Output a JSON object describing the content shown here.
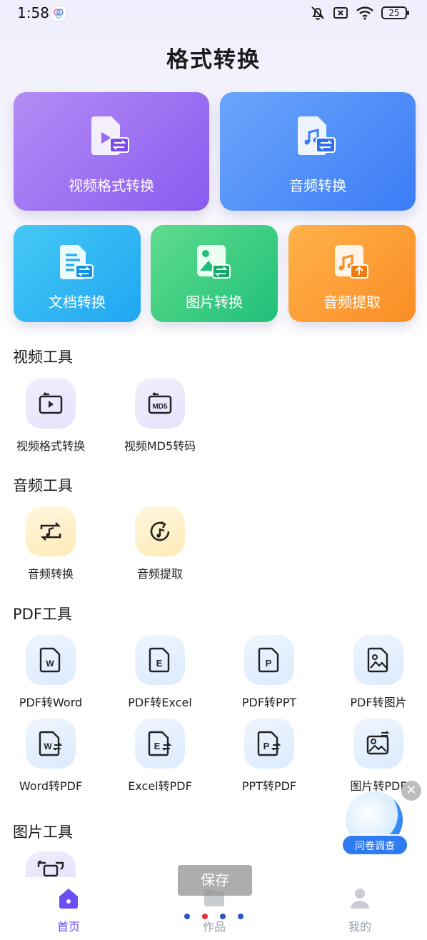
{
  "status_bar": {
    "time": "1:58",
    "battery": "25"
  },
  "page_title": "格式转换",
  "top_cards": [
    {
      "label": "视频格式转换"
    },
    {
      "label": "音频转换"
    },
    {
      "label": "文档转换"
    },
    {
      "label": "图片转换"
    },
    {
      "label": "音频提取"
    }
  ],
  "sections": {
    "video": {
      "title": "视频工具",
      "tools": [
        "视频格式转换",
        "视频MD5转码"
      ]
    },
    "audio": {
      "title": "音频工具",
      "tools": [
        "音频转换",
        "音频提取"
      ]
    },
    "pdf": {
      "title": "PDF工具",
      "tools": [
        "PDF转Word",
        "PDF转Excel",
        "PDF转PPT",
        "PDF转图片",
        "Word转PDF",
        "Excel转PDF",
        "PPT转PDF",
        "图片转PDF"
      ]
    },
    "image": {
      "title": "图片工具"
    }
  },
  "survey": {
    "label": "问卷调查"
  },
  "toast": "保存",
  "bottom_nav": [
    {
      "label": "首页",
      "active": true
    },
    {
      "label": "作品",
      "active": false
    },
    {
      "label": "我的",
      "active": false
    }
  ],
  "colors": {
    "accent": "#6b4ef2",
    "inactive": "#9aa0aa"
  }
}
